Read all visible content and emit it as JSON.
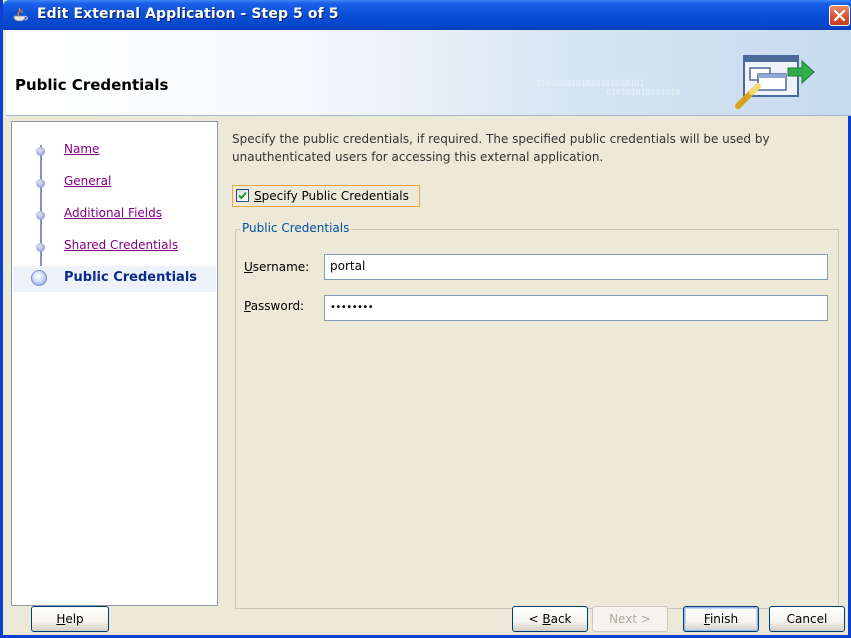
{
  "window": {
    "title": "Edit External Application - Step 5 of 5"
  },
  "header": {
    "title": "Public Credentials",
    "binary_rows": [
      "0101010101010101010101",
      "010101010101010"
    ]
  },
  "steps": [
    {
      "label": "Name",
      "active": false
    },
    {
      "label": "General",
      "active": false
    },
    {
      "label": "Additional Fields",
      "active": false
    },
    {
      "label": "Shared Credentials",
      "active": false
    },
    {
      "label": "Public Credentials",
      "active": true
    }
  ],
  "main": {
    "description": "Specify the public credentials, if required. The specified public credentials will be used by unauthenticated users for accessing this external application.",
    "checkbox": {
      "label_first": "S",
      "label_rest": "pecify Public Credentials",
      "checked": true
    },
    "group_label": "Public Credentials",
    "username": {
      "label_first": "U",
      "label_rest": "sername:",
      "value": "portal"
    },
    "password": {
      "label_first": "P",
      "label_rest": "assword:",
      "value": "••••••••"
    }
  },
  "buttons": {
    "help": {
      "first": "H",
      "rest": "elp"
    },
    "back": {
      "prefix": "< ",
      "first": "B",
      "rest": "ack"
    },
    "next": {
      "label": "Next >"
    },
    "finish": {
      "first": "F",
      "rest": "inish"
    },
    "cancel": {
      "label": "Cancel"
    }
  },
  "colors": {
    "titlebar": "#0a4fd8",
    "link_visited": "#800080",
    "active_step": "#0a2a8c",
    "group_label": "#0050a5"
  }
}
